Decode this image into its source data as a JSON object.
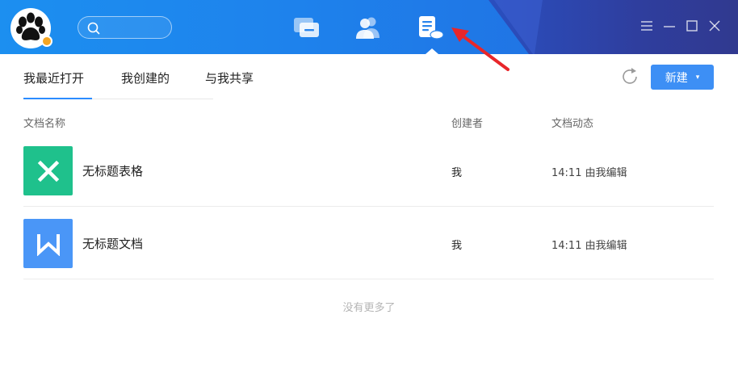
{
  "colors": {
    "accent": "#2b8cff",
    "topbar": "#1e82ec",
    "excel": "#1fc18c",
    "word": "#4a96f7",
    "annotation": "#e8262a"
  },
  "header": {
    "logo_icon": "paw-icon",
    "search_icon": "search-icon",
    "nav": [
      {
        "name": "messages",
        "icon": "chat-icon"
      },
      {
        "name": "contacts",
        "icon": "contacts-icon"
      },
      {
        "name": "documents",
        "icon": "document-icon",
        "active": true
      }
    ],
    "window_controls": [
      "menu-icon",
      "minimize-icon",
      "maximize-icon",
      "close-icon"
    ]
  },
  "tabs": [
    {
      "label": "我最近打开",
      "active": true
    },
    {
      "label": "我创建的"
    },
    {
      "label": "与我共享"
    }
  ],
  "toolbar": {
    "refresh_icon": "refresh-icon",
    "new_label": "新建",
    "new_caret": "▾"
  },
  "table": {
    "columns": [
      "文档名称",
      "创建者",
      "文档动态"
    ],
    "rows": [
      {
        "icon_letter": "X",
        "name": "无标题表格",
        "creator": "我",
        "activity": "14:11 由我编辑"
      },
      {
        "icon_letter": "W",
        "name": "无标题文档",
        "creator": "我",
        "activity": "14:11 由我编辑"
      }
    ]
  },
  "footer": {
    "no_more": "没有更多了"
  }
}
